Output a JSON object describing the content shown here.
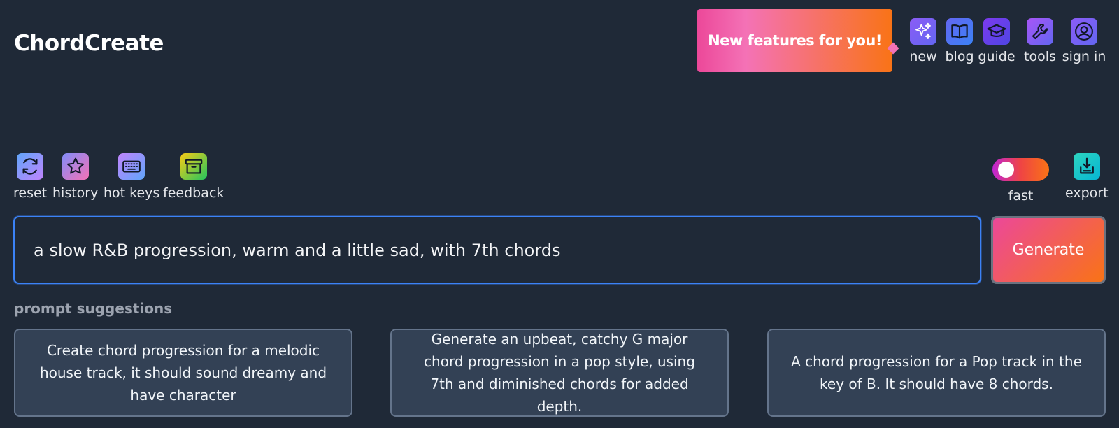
{
  "app": {
    "title": "ChordCreate"
  },
  "promo": {
    "text": "New features for you!"
  },
  "nav": {
    "new_label": "new",
    "blog_label": "blog",
    "guide_label": "guide",
    "tools_label": "tools",
    "signin_label": "sign in"
  },
  "toolbar": {
    "reset_label": "reset",
    "history_label": "history",
    "hotkeys_label": "hot keys",
    "feedback_label": "feedback",
    "fast_label": "fast",
    "export_label": "export"
  },
  "prompt": {
    "value": "a slow R&B progression, warm and a little sad, with 7th chords",
    "generate_label": "Generate"
  },
  "suggestions": {
    "heading": "prompt suggestions",
    "items": [
      "Create chord progression for a melodic house track, it should sound dreamy and have character",
      "Generate an upbeat, catchy G major chord progression in a pop style, using 7th and diminished chords for added depth.",
      "A chord progression for a Pop track in the key of B. It should have 8 chords."
    ]
  },
  "colors": {
    "background": "#1f2937",
    "accent_start": "#ec4899",
    "accent_end": "#f97316",
    "input_border": "#3b82f6"
  },
  "icons": [
    "sparkles-icon",
    "book-icon",
    "graduation-cap-icon",
    "wrench-icon",
    "user-circle-icon",
    "refresh-icon",
    "star-icon",
    "keyboard-icon",
    "archive-icon",
    "download-icon"
  ]
}
